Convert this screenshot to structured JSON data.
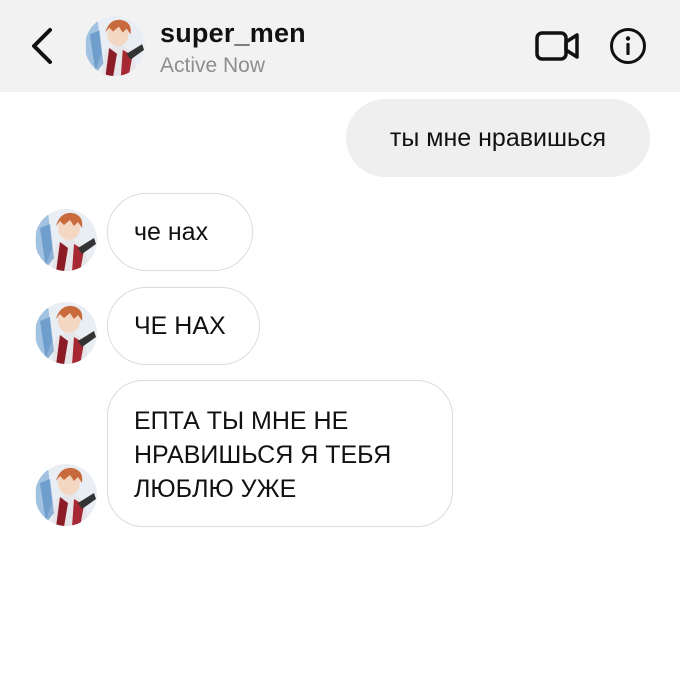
{
  "header": {
    "username": "super_men",
    "status": "Active Now",
    "icons": {
      "back": "chevron-left-icon",
      "video": "video-camera-icon",
      "info": "info-icon"
    }
  },
  "messages": [
    {
      "direction": "outgoing",
      "text": "ты мне нравишься"
    },
    {
      "direction": "incoming",
      "text": "че нах"
    },
    {
      "direction": "incoming",
      "text": "ЧЕ НАХ"
    },
    {
      "direction": "incoming",
      "lines": [
        "ЕПТА ТЫ МНЕ НЕ",
        "НРАВИШЬСЯ Я ТЕБЯ",
        "ЛЮБЛЮ УЖЕ"
      ]
    }
  ],
  "colors": {
    "header_bg": "#f2f2f2",
    "outgoing_bubble": "#efefef",
    "incoming_border": "#dbdbdb",
    "status_text": "#8e8e8e"
  }
}
